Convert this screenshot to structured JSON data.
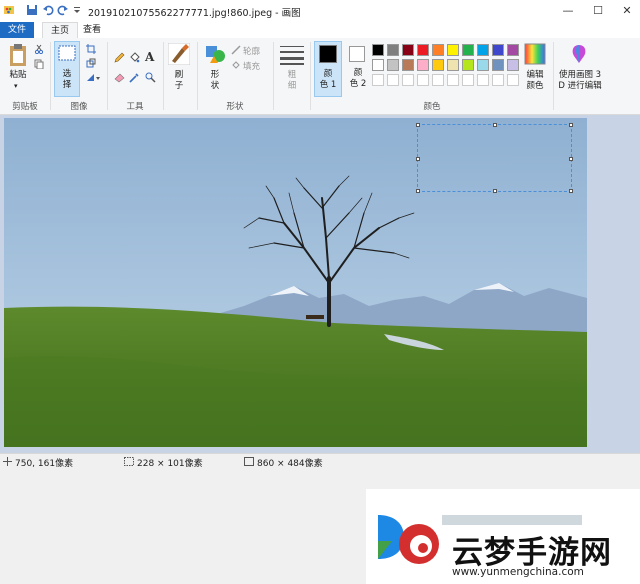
{
  "window": {
    "title": "20191021075562277771.jpg!860.jpeg - 画图",
    "controls": {
      "minimize": "—",
      "maximize": "☐",
      "close": "✕"
    }
  },
  "tabs": {
    "file": "文件",
    "home": "主页",
    "view": "查看"
  },
  "ribbon": {
    "clipboard": {
      "paste": "粘贴",
      "group": "剪贴板"
    },
    "image": {
      "select": "选",
      "select2": "择",
      "group": "图像"
    },
    "tools": {
      "group": "工具"
    },
    "brushes": {
      "label": "刷",
      "label2": "子"
    },
    "shapes": {
      "label": "形",
      "label2": "状",
      "outline": "轮廓",
      "fill": "填充",
      "group": "形状"
    },
    "size": {
      "label": "粗",
      "label2": "细"
    },
    "colors": {
      "color1": "颜",
      "color1b": "色 1",
      "color2": "颜",
      "color2b": "色 2",
      "edit1": "编辑",
      "edit2": "颜色",
      "group": "颜色",
      "palette": [
        [
          "#000000",
          "#7f7f7f",
          "#880015",
          "#ed1c24",
          "#ff7f27",
          "#fff200",
          "#22b14c",
          "#00a2e8",
          "#3f48cc",
          "#a349a4"
        ],
        [
          "#ffffff",
          "#c3c3c3",
          "#b97a57",
          "#ffaec9",
          "#ffc90e",
          "#efe4b0",
          "#b5e61d",
          "#99d9ea",
          "#7092be",
          "#c8bfe7"
        ],
        [
          "#ffffff",
          "#ffffff",
          "#ffffff",
          "#ffffff",
          "#ffffff",
          "#ffffff",
          "#ffffff",
          "#ffffff",
          "#ffffff",
          "#ffffff"
        ]
      ],
      "primary": "#000000",
      "secondary": "#ffffff"
    },
    "paint3d": {
      "line1": "使用画图 3",
      "line2": "D 进行编辑"
    }
  },
  "status": {
    "cursor": "750, 161像素",
    "selection": "228 × 101像素",
    "image_size": "860 × 484像素"
  },
  "watermark": {
    "brand": "云梦手游网",
    "url": "www.yunmengchina.com"
  }
}
